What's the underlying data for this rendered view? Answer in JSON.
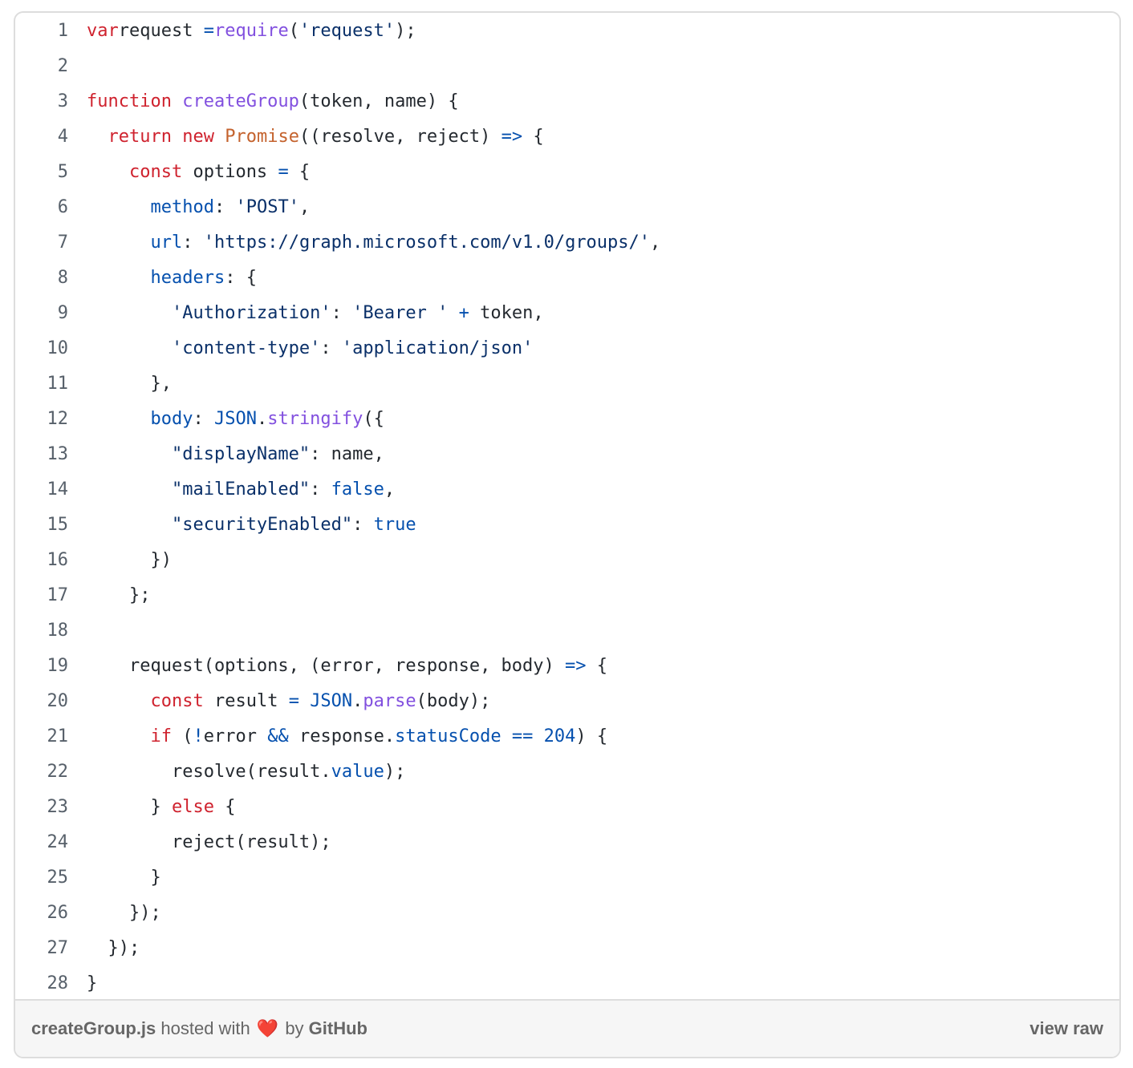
{
  "gist": {
    "filename": "createGroup.js",
    "hosted_text": " hosted with ",
    "heart_icon": "❤️",
    "by_text": " by ",
    "github_label": "GitHub",
    "view_raw_label": "view raw"
  },
  "code": {
    "language": "javascript",
    "lines": [
      {
        "n": "1",
        "tokens": [
          [
            "kw",
            "var"
          ],
          [
            "",
            "request "
          ],
          [
            "op",
            "="
          ],
          [
            "",
            ""
          ],
          [
            "fn",
            "require"
          ],
          [
            "",
            "("
          ],
          [
            "str",
            "'request'"
          ],
          [
            "",
            ");"
          ]
        ]
      },
      {
        "n": "2",
        "tokens": []
      },
      {
        "n": "3",
        "tokens": [
          [
            "kw",
            "function"
          ],
          [
            "",
            " "
          ],
          [
            "fn",
            "createGroup"
          ],
          [
            "",
            "(token, name) {"
          ]
        ]
      },
      {
        "n": "4",
        "tokens": [
          [
            "",
            "  "
          ],
          [
            "kw",
            "return"
          ],
          [
            "",
            " "
          ],
          [
            "kw",
            "new"
          ],
          [
            "",
            " "
          ],
          [
            "cls",
            "Promise"
          ],
          [
            "",
            "((resolve, reject) "
          ],
          [
            "op",
            "=>"
          ],
          [
            "",
            " {"
          ]
        ]
      },
      {
        "n": "5",
        "tokens": [
          [
            "",
            "    "
          ],
          [
            "kw",
            "const"
          ],
          [
            "",
            " options "
          ],
          [
            "op",
            "="
          ],
          [
            "",
            " {"
          ]
        ]
      },
      {
        "n": "6",
        "tokens": [
          [
            "",
            "      "
          ],
          [
            "prop",
            "method"
          ],
          [
            "",
            ": "
          ],
          [
            "str",
            "'POST'"
          ],
          [
            "",
            ","
          ]
        ]
      },
      {
        "n": "7",
        "tokens": [
          [
            "",
            "      "
          ],
          [
            "prop",
            "url"
          ],
          [
            "",
            ": "
          ],
          [
            "str",
            "'https://graph.microsoft.com/v1.0/groups/'"
          ],
          [
            "",
            ","
          ]
        ]
      },
      {
        "n": "8",
        "tokens": [
          [
            "",
            "      "
          ],
          [
            "prop",
            "headers"
          ],
          [
            "",
            ": {"
          ]
        ]
      },
      {
        "n": "9",
        "tokens": [
          [
            "",
            "        "
          ],
          [
            "str",
            "'Authorization'"
          ],
          [
            "",
            ": "
          ],
          [
            "str",
            "'Bearer '"
          ],
          [
            "",
            " "
          ],
          [
            "op",
            "+"
          ],
          [
            "",
            " token,"
          ]
        ]
      },
      {
        "n": "10",
        "tokens": [
          [
            "",
            "        "
          ],
          [
            "str",
            "'content-type'"
          ],
          [
            "",
            ": "
          ],
          [
            "str",
            "'application/json'"
          ]
        ]
      },
      {
        "n": "11",
        "tokens": [
          [
            "",
            "      },"
          ]
        ]
      },
      {
        "n": "12",
        "tokens": [
          [
            "",
            "      "
          ],
          [
            "prop",
            "body"
          ],
          [
            "",
            ": "
          ],
          [
            "op",
            "JSON"
          ],
          [
            "",
            "."
          ],
          [
            "fn",
            "stringify"
          ],
          [
            "",
            "({"
          ]
        ]
      },
      {
        "n": "13",
        "tokens": [
          [
            "",
            "        "
          ],
          [
            "str",
            "\"displayName\""
          ],
          [
            "",
            ": name,"
          ]
        ]
      },
      {
        "n": "14",
        "tokens": [
          [
            "",
            "        "
          ],
          [
            "str",
            "\"mailEnabled\""
          ],
          [
            "",
            ": "
          ],
          [
            "num",
            "false"
          ],
          [
            "",
            ","
          ]
        ]
      },
      {
        "n": "15",
        "tokens": [
          [
            "",
            "        "
          ],
          [
            "str",
            "\"securityEnabled\""
          ],
          [
            "",
            ": "
          ],
          [
            "num",
            "true"
          ]
        ]
      },
      {
        "n": "16",
        "tokens": [
          [
            "",
            "      })"
          ]
        ]
      },
      {
        "n": "17",
        "tokens": [
          [
            "",
            "    };"
          ]
        ]
      },
      {
        "n": "18",
        "tokens": []
      },
      {
        "n": "19",
        "tokens": [
          [
            "",
            "    request(options, (error, response, body) "
          ],
          [
            "op",
            "=>"
          ],
          [
            "",
            " {"
          ]
        ]
      },
      {
        "n": "20",
        "tokens": [
          [
            "",
            "      "
          ],
          [
            "kw",
            "const"
          ],
          [
            "",
            " result "
          ],
          [
            "op",
            "="
          ],
          [
            "",
            " "
          ],
          [
            "op",
            "JSON"
          ],
          [
            "",
            "."
          ],
          [
            "fn",
            "parse"
          ],
          [
            "",
            "(body);"
          ]
        ]
      },
      {
        "n": "21",
        "tokens": [
          [
            "",
            "      "
          ],
          [
            "kw",
            "if"
          ],
          [
            "",
            " ("
          ],
          [
            "op",
            "!"
          ],
          [
            "",
            "error "
          ],
          [
            "op",
            "&&"
          ],
          [
            "",
            " response."
          ],
          [
            "prop",
            "statusCode"
          ],
          [
            "",
            " "
          ],
          [
            "op",
            "=="
          ],
          [
            "",
            " "
          ],
          [
            "num",
            "204"
          ],
          [
            "",
            ") {"
          ]
        ]
      },
      {
        "n": "22",
        "tokens": [
          [
            "",
            "        resolve(result."
          ],
          [
            "prop",
            "value"
          ],
          [
            "",
            ");"
          ]
        ]
      },
      {
        "n": "23",
        "tokens": [
          [
            "",
            "      } "
          ],
          [
            "kw",
            "else"
          ],
          [
            "",
            " {"
          ]
        ]
      },
      {
        "n": "24",
        "tokens": [
          [
            "",
            "        reject(result);"
          ]
        ]
      },
      {
        "n": "25",
        "tokens": [
          [
            "",
            "      }"
          ]
        ]
      },
      {
        "n": "26",
        "tokens": [
          [
            "",
            "    });"
          ]
        ]
      },
      {
        "n": "27",
        "tokens": [
          [
            "",
            "  });"
          ]
        ]
      },
      {
        "n": "28",
        "tokens": [
          [
            "",
            "}"
          ]
        ]
      }
    ]
  }
}
